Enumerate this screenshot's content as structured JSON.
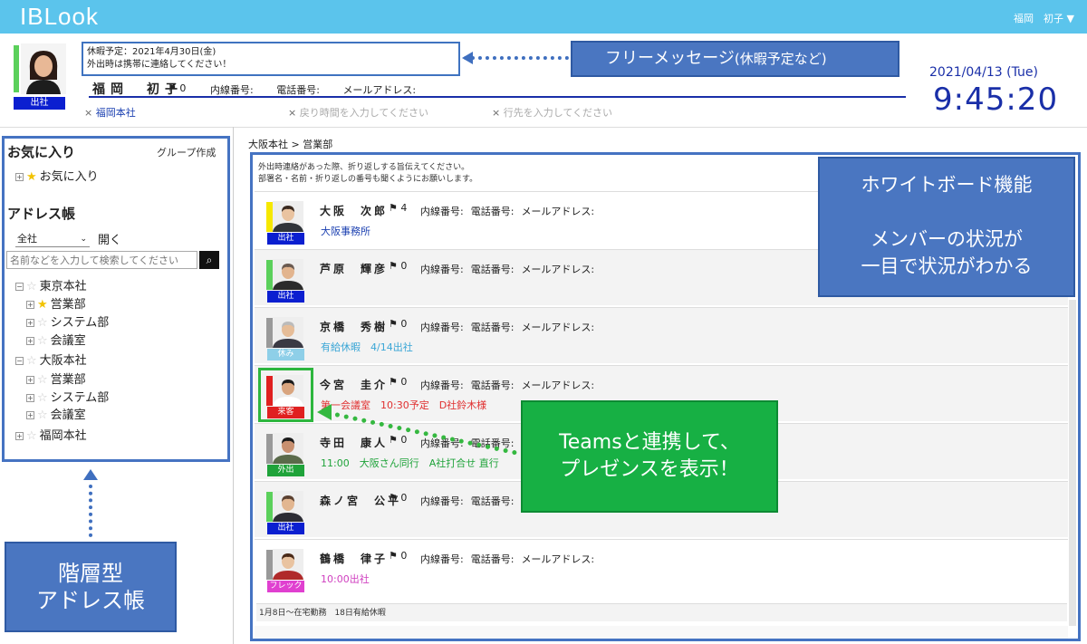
{
  "app": {
    "logo": "IBLook",
    "user_menu": "福岡　初子 ▼"
  },
  "me": {
    "status": "出社",
    "status_color": "#0b1fd0",
    "free_message_line1": "休暇予定：2021年4月30日(金)",
    "free_message_line2": "外出時は携帯に連絡してください！",
    "name": "福岡　初子",
    "flag": "0",
    "ext_label": "内線番号:",
    "phone_label": "電話番号:",
    "email_label": "メールアドレス:",
    "office": "福岡本社",
    "return_placeholder": "戻り時間を入力してください",
    "destination_placeholder": "行先を入力してください"
  },
  "clock": {
    "date": "2021/04/13 (Tue)",
    "time": "9:45:20"
  },
  "callouts": {
    "free_message": "フリーメッセージ",
    "free_message_sub": "(休暇予定など)",
    "address_line1": "階層型",
    "address_line2": "アドレス帳",
    "whiteboard_line1": "ホワイトボード機能",
    "whiteboard_line2": "メンバーの状況が",
    "whiteboard_line3": "一目で状況がわかる",
    "teams_line1": "Teamsと連携して、",
    "teams_line2": "プレゼンスを表示！"
  },
  "sidebar": {
    "favorites_title": "お気に入り",
    "group_create": "グループ作成",
    "favorites_item": "お気に入り",
    "address_title": "アドレス帳",
    "company_select": "全社",
    "open_button": "開く",
    "search_placeholder": "名前などを入力して検索してください",
    "tree": {
      "tokyo": "東京本社",
      "tokyo_sales": "営業部",
      "tokyo_system": "システム部",
      "tokyo_meeting": "会議室",
      "osaka": "大阪本社",
      "osaka_sales": "営業部",
      "osaka_system": "システム部",
      "osaka_meeting": "会議室",
      "fukuoka": "福岡本社"
    }
  },
  "main": {
    "breadcrumb": "大阪本社 > 営業部",
    "note_line1": "外出時連絡があった際、折り返しする旨伝えてください。",
    "note_line2": "部署名・名前・折り返しの番号も聞くようにお願いします。",
    "ext_label": "内線番号:",
    "phone_label": "電話番号:",
    "email_label": "メールアドレス:",
    "footer_note": "1月8日～在宅勤務　18日有給休暇",
    "members": [
      {
        "name": "大阪　次郎",
        "flag": "4",
        "status": "出社",
        "bar": "#f6e800",
        "status_color": "#0b1fd0",
        "note": "大阪事務所",
        "note_color": "#1a3fb0"
      },
      {
        "name": "芦原　輝彦",
        "flag": "0",
        "status": "出社",
        "bar": "#5bd05b",
        "status_color": "#0b1fd0",
        "note": "",
        "note_color": "#333"
      },
      {
        "name": "京橋　秀樹",
        "flag": "0",
        "status": "休み",
        "bar": "#999999",
        "status_color": "#8ecfe8",
        "note": "有給休暇　4/14出社",
        "note_color": "#3aa6d6"
      },
      {
        "name": "今宮　圭介",
        "flag": "0",
        "status": "来客",
        "bar": "#e02020",
        "status_color": "#e02020",
        "note": "第一会議室　10:30予定　D社鈴木様",
        "note_color": "#e03030"
      },
      {
        "name": "寺田　康人",
        "flag": "0",
        "status": "外出",
        "bar": "#999999",
        "status_color": "#1fa33a",
        "note": "11:00　大阪さん同行　A社打合せ 直行",
        "note_color": "#1fa33a"
      },
      {
        "name": "森ノ宮　公平",
        "flag": "0",
        "status": "出社",
        "bar": "#5bd05b",
        "status_color": "#0b1fd0",
        "note": "",
        "note_color": "#333"
      },
      {
        "name": "鶴橋　律子",
        "flag": "0",
        "status": "フレックス",
        "bar": "#999999",
        "status_color": "#e040d0",
        "note": "10:00出社",
        "note_color": "#d040c0"
      }
    ]
  }
}
